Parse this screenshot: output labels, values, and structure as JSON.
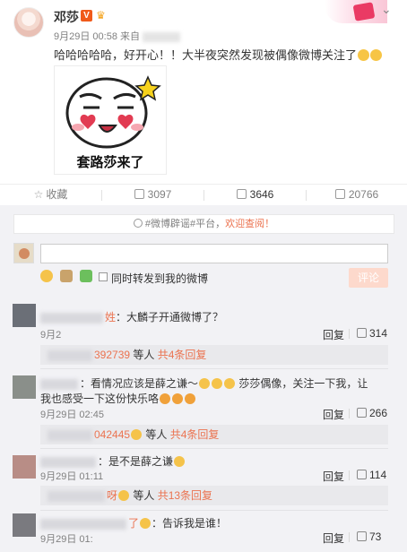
{
  "post": {
    "author": "邓莎",
    "vip_badge": "V",
    "meta_date": "9月29日 00:58 来自",
    "text": "哈哈哈哈哈，好开心！！大半夜突然发现被偶像微博关注了",
    "sticker_caption": "套路莎来了"
  },
  "actions": {
    "favorite": "收藏",
    "repost": "3097",
    "comment": "3646",
    "like": "20766"
  },
  "comment_area": {
    "notice_prefix": "#微博辟谣#平台，",
    "notice_link": "欢迎查阅！",
    "repost_checkbox_label": "同时转发到我的微博",
    "submit_label": "评论"
  },
  "comments": [
    {
      "name_suffix": "姓",
      "text": "：大麟子开通微博了？",
      "time": "9月2",
      "reply_label": "回复",
      "likes": "314",
      "sub_num": "392739",
      "sub_mid": " 等人 ",
      "sub_link": "共4条回复"
    },
    {
      "name_suffix": "",
      "text": "：看情况应该是薛之谦～",
      "text2": " 莎莎偶像，关注一下我，让",
      "text3": "我也感受一下这份快乐咯",
      "time": "9月29日 02:45",
      "reply_label": "回复",
      "likes": "266",
      "sub_num": "042445",
      "sub_mid": " 等人 ",
      "sub_link": "共4条回复"
    },
    {
      "name_suffix": "",
      "text": "：是不是薛之谦",
      "time": "9月29日 01:11",
      "reply_label": "回复",
      "likes": "114",
      "sub_num": "呀",
      "sub_mid": " 等人 ",
      "sub_link": "共13条回复"
    },
    {
      "name_suffix": "了",
      "text": "：告诉我是谁！",
      "time": "9月29日 01:",
      "reply_label": "回复",
      "likes": "73"
    }
  ]
}
